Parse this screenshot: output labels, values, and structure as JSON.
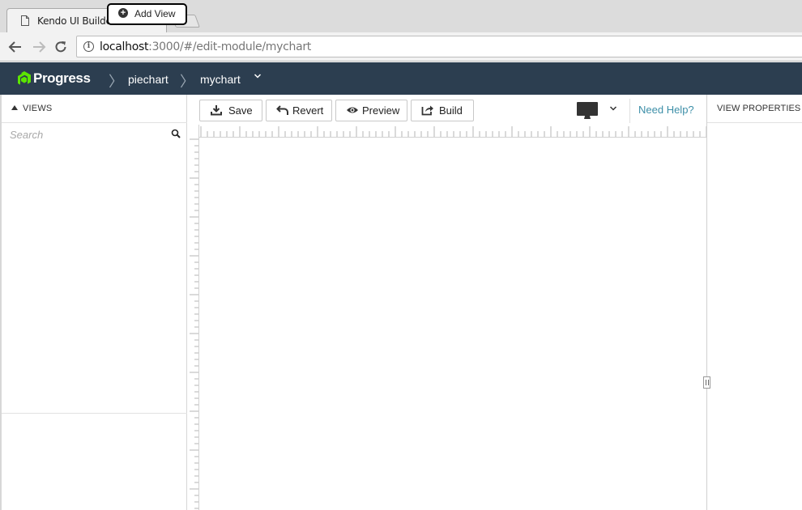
{
  "browser": {
    "tab_title": "Kendo UI Builder",
    "tab_close": "×",
    "url_host": "localhost",
    "url_path": ":3000/#/edit-module/mychart"
  },
  "header": {
    "logo_text": "Progress",
    "logo_registered": "·",
    "breadcrumbs": [
      "piechart",
      "mychart"
    ]
  },
  "views_panel": {
    "title": "VIEWS",
    "add_view_label": "Add View",
    "search_placeholder": "Search"
  },
  "toolbar": {
    "save_label": "Save",
    "revert_label": "Revert",
    "preview_label": "Preview",
    "build_label": "Build",
    "need_help_label": "Need Help?"
  },
  "properties_panel": {
    "title": "VIEW PROPERTIES"
  },
  "colors": {
    "header_bg": "#2c3e50",
    "logo_green": "#5ce500",
    "link": "#3d8fa8"
  },
  "icons": [
    "document-icon",
    "close-icon",
    "back-icon",
    "forward-icon",
    "reload-icon",
    "info-icon",
    "progress-logo-icon",
    "chevron-down-icon",
    "triangle-up-icon",
    "plus-circle-icon",
    "search-icon",
    "save-icon",
    "revert-icon",
    "preview-eye-icon",
    "build-icon",
    "desktop-icon"
  ]
}
